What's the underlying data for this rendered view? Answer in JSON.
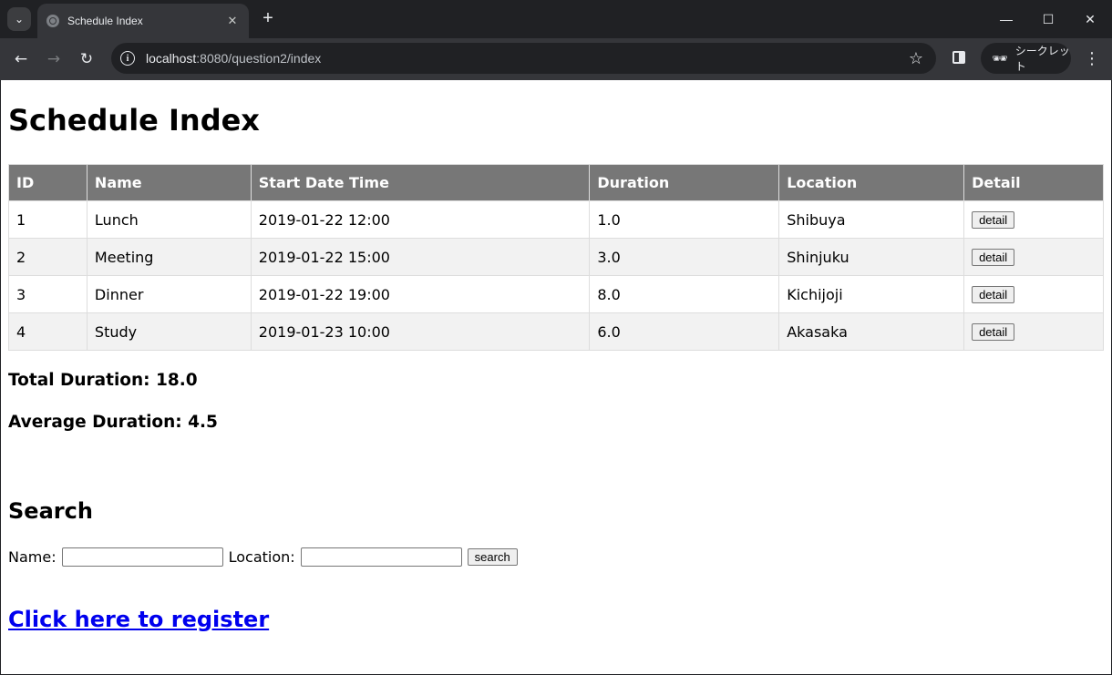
{
  "browser": {
    "tab_title": "Schedule Index",
    "url_host": "localhost",
    "url_path": ":8080/question2/index",
    "incognito_label": "シークレット"
  },
  "page": {
    "title": "Schedule Index",
    "table": {
      "headers": [
        "ID",
        "Name",
        "Start Date Time",
        "Duration",
        "Location",
        "Detail"
      ],
      "rows": [
        {
          "id": "1",
          "name": "Lunch",
          "start": "2019-01-22 12:00",
          "duration": "1.0",
          "location": "Shibuya",
          "detail": "detail"
        },
        {
          "id": "2",
          "name": "Meeting",
          "start": "2019-01-22 15:00",
          "duration": "3.0",
          "location": "Shinjuku",
          "detail": "detail"
        },
        {
          "id": "3",
          "name": "Dinner",
          "start": "2019-01-22 19:00",
          "duration": "8.0",
          "location": "Kichijoji",
          "detail": "detail"
        },
        {
          "id": "4",
          "name": "Study",
          "start": "2019-01-23 10:00",
          "duration": "6.0",
          "location": "Akasaka",
          "detail": "detail"
        }
      ]
    },
    "total_duration": "Total Duration: 18.0",
    "average_duration": "Average Duration: 4.5",
    "search": {
      "title": "Search",
      "name_label": "Name:",
      "name_value": "",
      "location_label": "Location:",
      "location_value": "",
      "button": "search"
    },
    "register_link": "Click here to register"
  }
}
